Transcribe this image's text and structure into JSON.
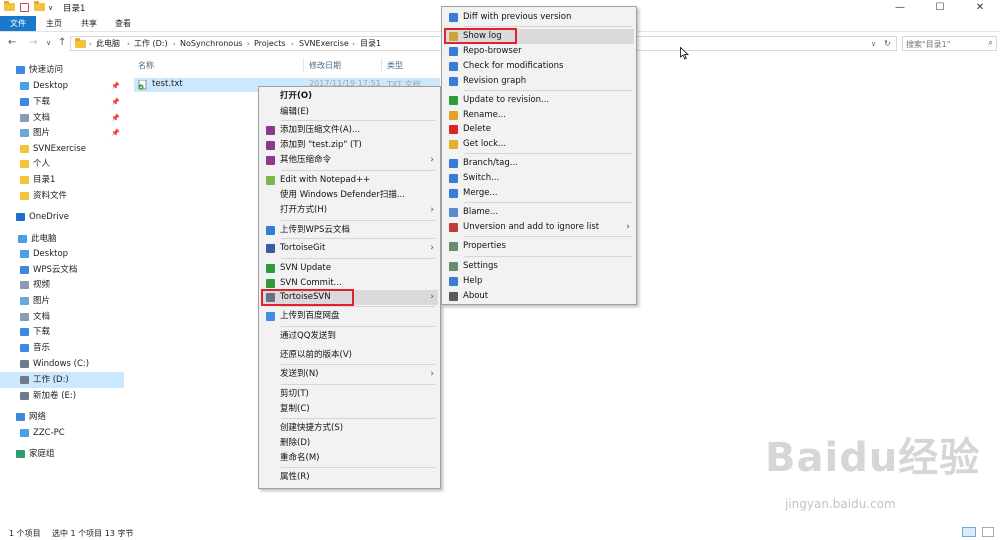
{
  "window": {
    "title": "目录1",
    "quick_access_caret": "∨",
    "min_glyph": "—",
    "max_glyph": "☐",
    "close_glyph": "✕"
  },
  "ribbon": {
    "tabs": [
      "文件",
      "主页",
      "共享",
      "查看"
    ]
  },
  "nav": {
    "back": "←",
    "forward": "→",
    "recent": "∨",
    "up": "↑",
    "breadcrumb": [
      "此电脑",
      "工作 (D:)",
      "NoSynchronous",
      "Projects",
      "SVNExercise",
      "目录1"
    ],
    "refresh": "↻",
    "dropdown": "∨",
    "search_placeholder": "搜索\"目录1\""
  },
  "sidebar": {
    "items": [
      {
        "label": "快速访问",
        "icon": "star-icon",
        "color": "#3b8ae0",
        "pinned": false
      },
      {
        "label": "Desktop",
        "icon": "desktop-icon",
        "color": "#4a9ee6",
        "pinned": true
      },
      {
        "label": "下载",
        "icon": "download-icon",
        "color": "#3b8ae0",
        "pinned": true
      },
      {
        "label": "文档",
        "icon": "document-icon",
        "color": "#8a9bb0",
        "pinned": true
      },
      {
        "label": "图片",
        "icon": "picture-icon",
        "color": "#6aa8d8",
        "pinned": true
      },
      {
        "label": "SVNExercise",
        "icon": "svn-folder-icon",
        "color": "#f3c33b",
        "pinned": false
      },
      {
        "label": "个人",
        "icon": "folder-icon",
        "color": "#f3c33b",
        "pinned": false
      },
      {
        "label": "目录1",
        "icon": "svn-folder-icon",
        "color": "#f3c33b",
        "pinned": false
      },
      {
        "label": "资料文件",
        "icon": "svn-folder-icon",
        "color": "#f3c33b",
        "pinned": false
      },
      {
        "label": "OneDrive",
        "icon": "cloud-icon",
        "color": "#1f6fc6",
        "pinned": false
      },
      {
        "label": "此电脑",
        "icon": "computer-icon",
        "color": "#4a9ee6",
        "pinned": false
      },
      {
        "label": "Desktop",
        "icon": "desktop-icon",
        "color": "#4a9ee6",
        "pinned": false
      },
      {
        "label": "WPS云文档",
        "icon": "cloud-doc-icon",
        "color": "#3b8ae0",
        "pinned": false
      },
      {
        "label": "视频",
        "icon": "video-icon",
        "color": "#8a9bb0",
        "pinned": false
      },
      {
        "label": "图片",
        "icon": "picture-icon",
        "color": "#6aa8d8",
        "pinned": false
      },
      {
        "label": "文档",
        "icon": "document-icon",
        "color": "#8a9bb0",
        "pinned": false
      },
      {
        "label": "下载",
        "icon": "download-icon",
        "color": "#3b8ae0",
        "pinned": false
      },
      {
        "label": "音乐",
        "icon": "music-icon",
        "color": "#3b8ae0",
        "pinned": false
      },
      {
        "label": "Windows (C:)",
        "icon": "drive-icon",
        "color": "#6e7b8b",
        "pinned": false
      },
      {
        "label": "工作 (D:)",
        "icon": "drive-icon",
        "color": "#6e7b8b",
        "pinned": false,
        "selected": true
      },
      {
        "label": "新加卷 (E:)",
        "icon": "drive-icon",
        "color": "#6e7b8b",
        "pinned": false
      },
      {
        "label": "网络",
        "icon": "network-icon",
        "color": "#3b8ae0",
        "pinned": false
      },
      {
        "label": "ZZC-PC",
        "icon": "computer-icon",
        "color": "#4a9ee6",
        "pinned": false
      },
      {
        "label": "家庭组",
        "icon": "homegroup-icon",
        "color": "#2f9e6e",
        "pinned": false
      }
    ],
    "pin_glyph": "📌"
  },
  "filelist": {
    "columns": [
      "名称",
      "修改日期",
      "类型"
    ],
    "rows": [
      {
        "name": "test.txt",
        "date": "2017/11/19 17:51",
        "type": "TXT 文档"
      }
    ]
  },
  "context_menu": {
    "items": [
      {
        "label": "打开(O)",
        "bold": true
      },
      {
        "label": "编辑(E)"
      },
      {
        "label": "添加到压缩文件(A)...",
        "icon": "winrar-icon"
      },
      {
        "label": "添加到 \"test.zip\" (T)",
        "icon": "winrar-icon"
      },
      {
        "label": "其他压缩命令",
        "icon": "winrar-icon",
        "submenu": true
      },
      {
        "label": "Edit with Notepad++",
        "icon": "notepadpp-icon"
      },
      {
        "label": "使用 Windows Defender扫描..."
      },
      {
        "label": "打开方式(H)",
        "submenu": true
      },
      {
        "label": "上传到WPS云文档",
        "icon": "wps-cloud-icon"
      },
      {
        "label": "TortoiseGit",
        "icon": "tortoisegit-icon",
        "submenu": true
      },
      {
        "label": "SVN Update",
        "icon": "svn-update-icon"
      },
      {
        "label": "SVN Commit...",
        "icon": "svn-commit-icon"
      },
      {
        "label": "TortoiseSVN",
        "icon": "tortoisesvn-icon",
        "submenu": true,
        "highlighted": true
      },
      {
        "label": "上传到百度网盘",
        "icon": "baidu-pan-icon"
      },
      {
        "label": "通过QQ发送到"
      },
      {
        "label": "还原以前的版本(V)"
      },
      {
        "label": "发送到(N)",
        "submenu": true
      },
      {
        "label": "剪切(T)"
      },
      {
        "label": "复制(C)"
      },
      {
        "label": "创建快捷方式(S)"
      },
      {
        "label": "删除(D)"
      },
      {
        "label": "重命名(M)"
      },
      {
        "label": "属性(R)"
      }
    ],
    "arrow_glyph": "›"
  },
  "svn_menu": {
    "items": [
      {
        "label": "Diff with previous version",
        "icon": "diff-icon"
      },
      {
        "label": "Show log",
        "icon": "show-log-icon",
        "highlighted": true
      },
      {
        "label": "Repo-browser",
        "icon": "repo-browser-icon"
      },
      {
        "label": "Check for modifications",
        "icon": "check-modifications-icon"
      },
      {
        "label": "Revision graph",
        "icon": "revision-graph-icon"
      },
      {
        "label": "Update to revision...",
        "icon": "update-revision-icon"
      },
      {
        "label": "Rename...",
        "icon": "rename-icon"
      },
      {
        "label": "Delete",
        "icon": "delete-icon"
      },
      {
        "label": "Get lock...",
        "icon": "lock-icon"
      },
      {
        "label": "Branch/tag...",
        "icon": "branch-icon"
      },
      {
        "label": "Switch...",
        "icon": "switch-icon"
      },
      {
        "label": "Merge...",
        "icon": "merge-icon"
      },
      {
        "label": "Blame...",
        "icon": "blame-icon"
      },
      {
        "label": "Unversion and add to ignore list",
        "icon": "ignore-icon",
        "submenu": true
      },
      {
        "label": "Properties",
        "icon": "properties-icon"
      },
      {
        "label": "Settings",
        "icon": "settings-icon"
      },
      {
        "label": "Help",
        "icon": "help-icon"
      },
      {
        "label": "About",
        "icon": "about-icon"
      }
    ]
  },
  "status": {
    "count": "1 个项目",
    "selection": "选中 1 个项目  13 字节"
  },
  "watermark": {
    "logo": "Baidu经验",
    "url": "jingyan.baidu.com"
  }
}
